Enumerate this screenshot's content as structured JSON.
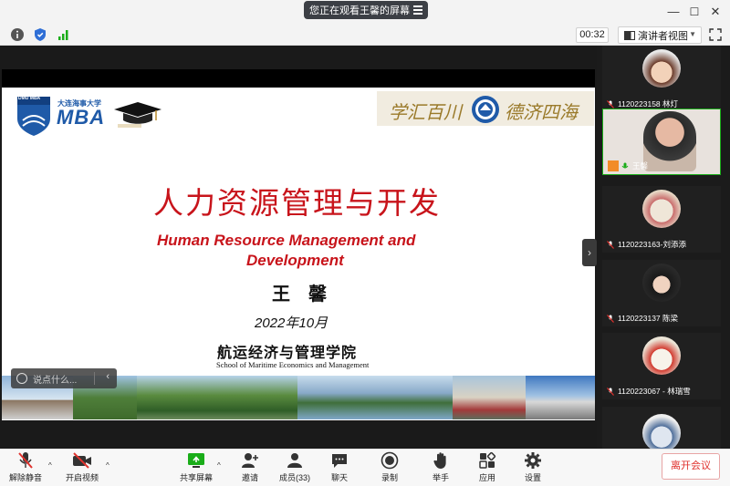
{
  "titlebar": {
    "sharing_text": "您正在观看王馨的屏幕",
    "minimize": "—",
    "maximize": "☐",
    "close": "✕"
  },
  "toolbar": {
    "timer": "00:32",
    "view_label": "演讲者视图"
  },
  "slide": {
    "school_small": "大连海事大学",
    "mba": "MBA",
    "dmu": "DMU MBA",
    "title_zh": "人力资源管理与开发",
    "title_en_line1": "Human Resource Management and",
    "title_en_line2": "Development",
    "author": "王　馨",
    "date": "2022年10月",
    "school_zh": "航运经济与管理学院",
    "school_en": "School of Maritime Economics and Management",
    "calligraphy_left": "学汇百川",
    "calligraphy_right": "德济四海"
  },
  "chat": {
    "placeholder": "说点什么..."
  },
  "participants": [
    {
      "name": "1120223158 林灯",
      "muted": true
    },
    {
      "name": "王馨",
      "muted": false,
      "active": true
    },
    {
      "name": "1120223163-刘添添",
      "muted": true
    },
    {
      "name": "1120223137 陈梁",
      "muted": true
    },
    {
      "name": "1120223067 - 林瑞雪",
      "muted": true
    },
    {
      "name": "",
      "muted": true
    }
  ],
  "bottombar": {
    "unmute": "解除静音",
    "start_video": "开启视频",
    "share_screen": "共享屏幕",
    "invite": "邀请",
    "members": "成员(33)",
    "chat": "聊天",
    "record": "录制",
    "raise_hand": "举手",
    "apps": "应用",
    "settings": "设置",
    "leave": "离开会议"
  },
  "colors": {
    "accent_green": "#1aad19",
    "leave_red": "#e0322d",
    "title_red": "#c8141b",
    "mba_blue": "#1f5aa8"
  }
}
